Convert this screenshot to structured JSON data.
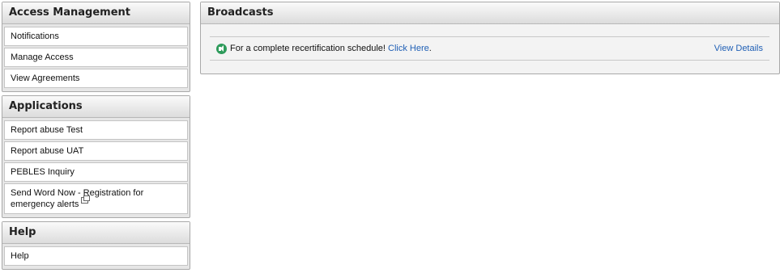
{
  "sidebar": {
    "access": {
      "title": "Access Management",
      "items": [
        {
          "label": "Notifications"
        },
        {
          "label": "Manage Access"
        },
        {
          "label": "View Agreements"
        }
      ]
    },
    "applications": {
      "title": "Applications",
      "items": [
        {
          "label": "Report abuse Test"
        },
        {
          "label": "Report abuse UAT"
        },
        {
          "label": "PEBLES Inquiry"
        },
        {
          "label": "Send Word Now - Registration for emergency alerts"
        }
      ]
    },
    "help": {
      "title": "Help",
      "items": [
        {
          "label": "Help"
        }
      ]
    }
  },
  "broadcasts": {
    "title": "Broadcasts",
    "message": "For a complete recertification schedule!",
    "link_label": "Click Here",
    "link_suffix": ".",
    "view_details": "View Details",
    "icon": "megaphone-icon"
  },
  "colors": {
    "link": "#1f5fb5",
    "icon_green": "#2e9b5b"
  }
}
